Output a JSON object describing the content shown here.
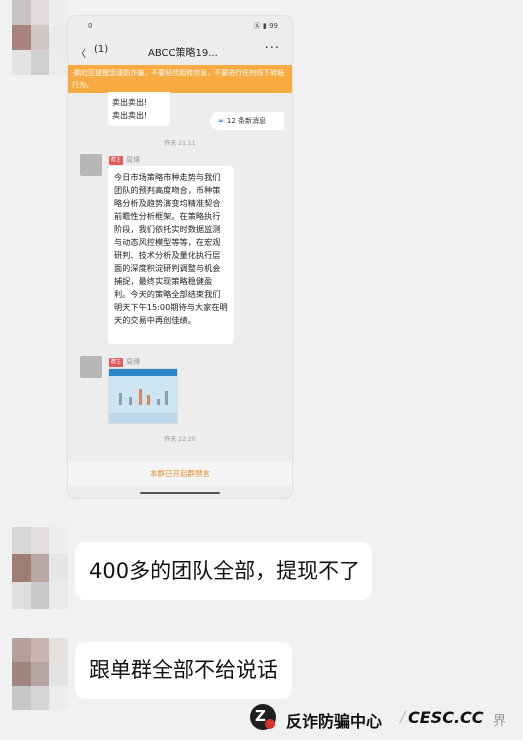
{
  "phone": {
    "status_time": "0",
    "status_right": "Ⓐ ▮ 99",
    "nav": {
      "back": "〈",
      "count": "(1)",
      "title": "ABCC策略19...",
      "more": "···"
    },
    "banner": "·鹏社区提醒您谨防诈骗，不要轻信陌转信息，不要进行任何线下转账行为。",
    "top_bubble": [
      "卖出卖出!",
      "卖出卖出!"
    ],
    "new_messages": "12 条新消息",
    "timestamp_1": "昨天 21:11",
    "sender_badge": "群主",
    "sender_name": "周博",
    "main_message": "今日市场策略市种走势与我们团队的预判高度吻合，币种策略分析及趋势演变均精准契合前瞻性分析框架。在策略执行阶段，我们依托实时数据监测与动态风控模型等等，在宏观研判、技术分析及量化执行层面的深度积淀研判调整与机会捕捉，最终实现策略稳健盈利。今天的策略全部结束我们明天下午15:00期待与大家在明天的交易中再创佳绩。",
    "sender2_badge": "群主",
    "sender2_name": "周博",
    "timestamp_2": "昨天 22:20",
    "bottom_notice": "本群已开启群禁言"
  },
  "messages": [
    {
      "text": "400多的团队全部，提现不了"
    },
    {
      "text": "跟单群全部不给说话"
    }
  ],
  "watermark": {
    "logo_icon": "fraud-center-logo",
    "name": "反诈防骗中心",
    "separator": "/",
    "site": "CESC.CC",
    "tail": "界"
  },
  "colors": {
    "banner": "#f7ab41",
    "notice": "#e98a27",
    "badge": "#e2595a",
    "link": "#3a7bd5"
  }
}
